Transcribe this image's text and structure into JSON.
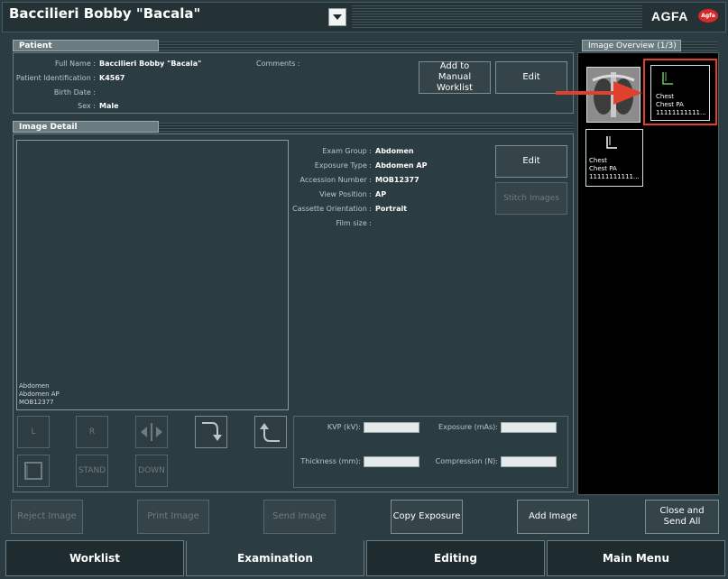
{
  "header": {
    "patient_title": "Baccilieri Bobby \"Bacala\"",
    "brand": "AGFA",
    "brand_logo_text": "Agfa"
  },
  "patient": {
    "section_title": "Patient",
    "full_name_label": "Full Name :",
    "full_name": "Baccilieri Bobby \"Bacala\"",
    "id_label": "Patient Identification :",
    "id": "K4567",
    "birth_label": "Birth Date :",
    "birth": "",
    "sex_label": "Sex :",
    "sex": "Male",
    "comments_label": "Comments :",
    "add_manual_button": "Add to Manual Worklist",
    "edit_button": "Edit"
  },
  "image_detail": {
    "section_title": "Image Detail",
    "exam_group_label": "Exam Group :",
    "exam_group": "Abdomen",
    "exposure_type_label": "Exposure Type :",
    "exposure_type": "Abdomen AP",
    "accession_label": "Accession Number :",
    "accession": "MOB12377",
    "view_position_label": "View Position :",
    "view_position": "AP",
    "cassette_label": "Cassette Orientation :",
    "cassette": "Portrait",
    "film_size_label": "Film size :",
    "film_size": "",
    "edit_button": "Edit",
    "stitch_button": "Stitch Images",
    "preview_lines": [
      "Abdomen",
      "Abdomen AP",
      "MOB12377"
    ],
    "tools": {
      "L": "L",
      "R": "R",
      "stand": "STAND",
      "down": "DOWN"
    },
    "exposure": {
      "kvp_label": "KVP (kV):",
      "kvp_value": "",
      "mas_label": "Exposure (mAs):",
      "mas_value": "",
      "thickness_label": "Thickness (mm):",
      "thickness_value": "",
      "compression_label": "Compression (N):",
      "compression_value": ""
    }
  },
  "overview": {
    "title": "Image Overview (1/3)",
    "thumbs": [
      {
        "lines": [
          "Chest",
          "Chest PA",
          "11111111111..."
        ]
      },
      {
        "lines": [
          "Chest",
          "Chest PA",
          "11111111111..."
        ]
      }
    ]
  },
  "actions": {
    "reject": "Reject Image",
    "print": "Print Image",
    "send": "Send Image",
    "copy_exposure": "Copy Exposure",
    "add_image": "Add Image",
    "close_send_all": "Close and Send All"
  },
  "nav": {
    "worklist": "Worklist",
    "examination": "Examination",
    "editing": "Editing",
    "main_menu": "Main Menu"
  },
  "colors": {
    "background": "#2b3c42",
    "highlight_red": "#e0402e",
    "active_tab": "#2b3c42"
  }
}
